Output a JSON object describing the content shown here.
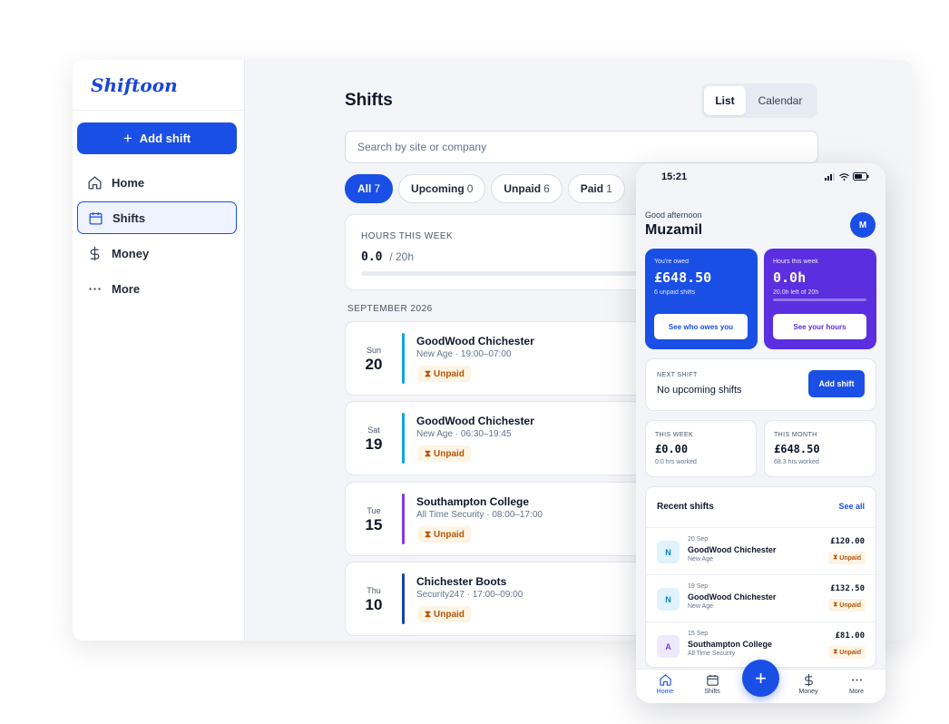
{
  "app": {
    "logo": "Shiftoon"
  },
  "sidebar": {
    "add_label": "Add shift",
    "items": [
      {
        "label": "Home",
        "icon": "home-icon"
      },
      {
        "label": "Shifts",
        "icon": "calendar-icon"
      },
      {
        "label": "Money",
        "icon": "dollar-icon"
      },
      {
        "label": "More",
        "icon": "more-icon"
      }
    ]
  },
  "main": {
    "title": "Shifts",
    "view_toggle": {
      "list": "List",
      "calendar": "Calendar"
    },
    "search_placeholder": "Search by site or company",
    "filters": [
      {
        "label": "All",
        "count": "7"
      },
      {
        "label": "Upcoming",
        "count": "0"
      },
      {
        "label": "Unpaid",
        "count": "6"
      },
      {
        "label": "Paid",
        "count": "1"
      }
    ],
    "hours_week": {
      "label": "HOURS THIS WEEK",
      "value": "0.0",
      "of": "/ 20h",
      "progress": 0
    },
    "month_label": "SEPTEMBER 2026",
    "shifts": [
      {
        "dow": "Sun",
        "day": "20",
        "site": "GoodWood Chichester",
        "sub": "New Age · 19:00–07:00",
        "status": "Unpaid",
        "accent": "#0ea5e9"
      },
      {
        "dow": "Sat",
        "day": "19",
        "site": "GoodWood Chichester",
        "sub": "New Age · 06:30–19:45",
        "status": "Unpaid",
        "accent": "#0ea5e9"
      },
      {
        "dow": "Tue",
        "day": "15",
        "site": "Southampton College",
        "sub": "All Time Security · 08:00–17:00",
        "status": "Unpaid",
        "accent": "#7c3aed"
      },
      {
        "dow": "Thu",
        "day": "10",
        "site": "Chichester Boots",
        "sub": "Security247 · 17:00–09:00",
        "status": "Unpaid",
        "accent": "#1e40af"
      }
    ]
  },
  "phone": {
    "time": "15:21",
    "greeting": "Good afternoon",
    "user": "Muzamil",
    "avatar": "M",
    "owed": {
      "label": "You're owed",
      "value": "£648.50",
      "sub": "6 unpaid shifts",
      "button": "See who owes you"
    },
    "hours": {
      "label": "Hours this week",
      "value": "0.0h",
      "sub": "20.0h left of 20h",
      "button": "See your hours",
      "progress": 0
    },
    "next": {
      "label": "NEXT SHIFT",
      "value": "No upcoming shifts",
      "button": "Add shift"
    },
    "week": {
      "label": "THIS WEEK",
      "value": "£0.00",
      "sub": "0.0 hrs worked"
    },
    "month": {
      "label": "THIS MONTH",
      "value": "£648.50",
      "sub": "68.3 hrs worked"
    },
    "recent": {
      "title": "Recent shifts",
      "see_all": "See all",
      "items": [
        {
          "avatar": "N",
          "date": "20 Sep",
          "site": "GoodWood Chichester",
          "company": "New Age",
          "amount": "£120.00",
          "status": "Unpaid"
        },
        {
          "avatar": "N",
          "date": "19 Sep",
          "site": "GoodWood Chichester",
          "company": "New Age",
          "amount": "£132.50",
          "status": "Unpaid"
        },
        {
          "avatar": "A",
          "date": "15 Sep",
          "site": "Southampton College",
          "company": "All Time Security",
          "amount": "£81.00",
          "status": "Unpaid"
        }
      ]
    },
    "tabs": {
      "home": "Home",
      "shifts": "Shifts",
      "money": "Money",
      "more": "More"
    }
  },
  "colors": {
    "primary": "#1a4fe6",
    "purple": "#5b2ee0",
    "unpaid_bg": "#fdf4e4",
    "unpaid_text": "#b45309"
  }
}
